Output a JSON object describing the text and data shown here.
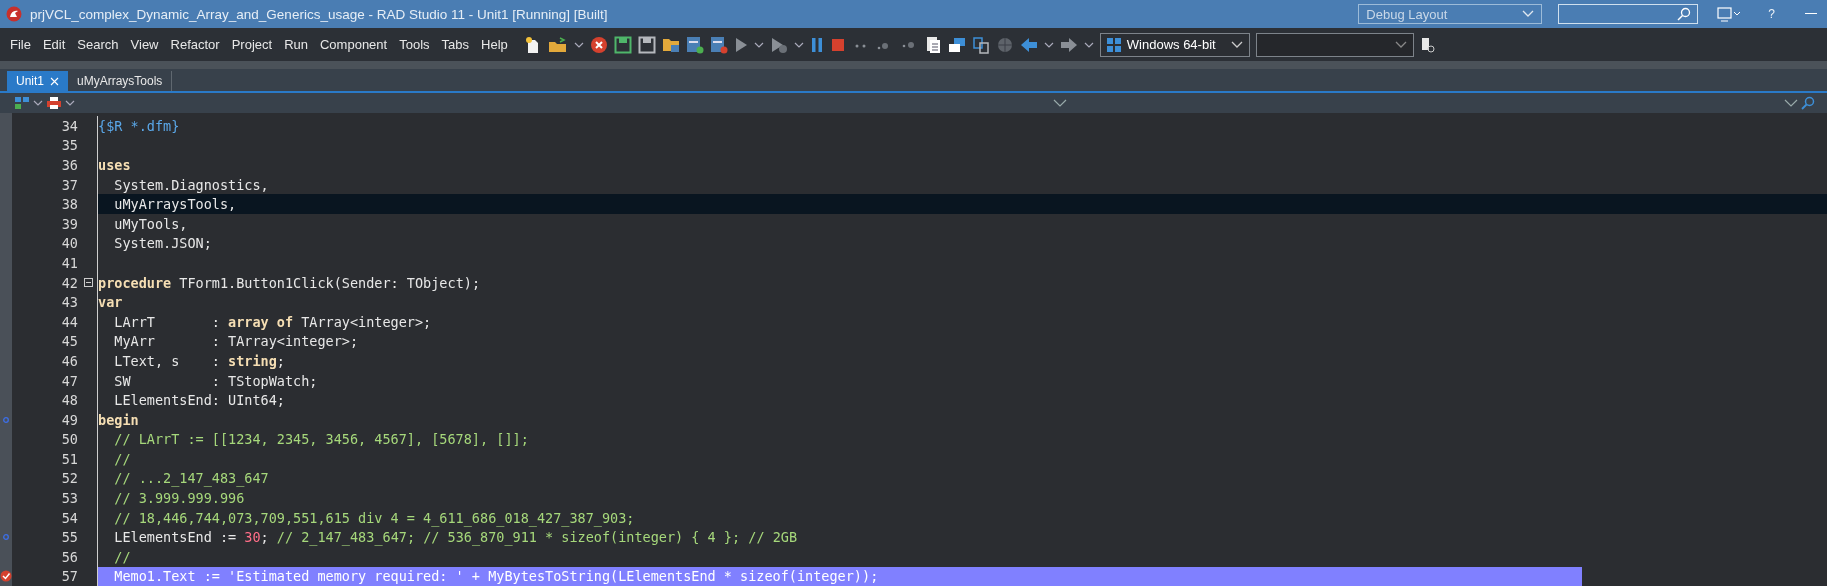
{
  "window": {
    "title": "prjVCL_complex_Dynamic_Array_and_Generics_usage - RAD Studio 11 - Unit1 [Running] [Built]",
    "layout": "Debug Layout",
    "help": "?"
  },
  "menu": [
    "File",
    "Edit",
    "Search",
    "View",
    "Refactor",
    "Project",
    "Run",
    "Component",
    "Tools",
    "Tabs",
    "Help"
  ],
  "platform": "Windows 64-bit",
  "tabs": [
    {
      "label": "Unit1",
      "selected": true
    },
    {
      "label": "uMyArraysTools",
      "selected": false
    }
  ],
  "code": [
    {
      "n": "34",
      "kind": "normal",
      "tokens": [
        {
          "kind": "directive",
          "text": "{$R *.dfm}"
        }
      ]
    },
    {
      "n": "35",
      "kind": "normal"
    },
    {
      "n": "36",
      "kind": "normal",
      "tokens": [
        {
          "kind": "keyword",
          "text": "uses"
        }
      ]
    },
    {
      "n": "37",
      "kind": "normal",
      "tokens": [
        {
          "kind": "plain",
          "text": "  System.Diagnostics,"
        }
      ]
    },
    {
      "n": "38",
      "kind": "caret",
      "tokens": [
        {
          "kind": "plain",
          "text": "  uMyArraysTools,"
        }
      ]
    },
    {
      "n": "39",
      "kind": "normal",
      "tokens": [
        {
          "kind": "plain",
          "text": "  uMyTools,"
        }
      ]
    },
    {
      "n": "40",
      "kind": "normal",
      "tokens": [
        {
          "kind": "plain",
          "text": "  System.JSON;"
        }
      ]
    },
    {
      "n": "41",
      "kind": "normal"
    },
    {
      "n": "42",
      "kind": "normal",
      "fold": {
        "expanded": true
      },
      "tokens": [
        {
          "kind": "keyword",
          "text": "procedure"
        },
        {
          "kind": "plain",
          "text": " TForm1.Button1Click(Sender: TObject);"
        }
      ]
    },
    {
      "n": "43",
      "kind": "normal",
      "tokens": [
        {
          "kind": "keyword",
          "text": "var"
        }
      ]
    },
    {
      "n": "44",
      "kind": "normal",
      "tokens": [
        {
          "kind": "plain",
          "text": "  LArrT       : "
        },
        {
          "kind": "keyword",
          "text": "array of"
        },
        {
          "kind": "plain",
          "text": " TArray<integer>;"
        }
      ]
    },
    {
      "n": "45",
      "kind": "normal",
      "tokens": [
        {
          "kind": "plain",
          "text": "  MyArr       : TArray<integer>;"
        }
      ]
    },
    {
      "n": "46",
      "kind": "normal",
      "tokens": [
        {
          "kind": "plain",
          "text": "  LText, s    : "
        },
        {
          "kind": "keyword",
          "text": "string"
        },
        {
          "kind": "plain",
          "text": ";"
        }
      ]
    },
    {
      "n": "47",
      "kind": "normal",
      "tokens": [
        {
          "kind": "plain",
          "text": "  SW          : TStopWatch;"
        }
      ]
    },
    {
      "n": "48",
      "kind": "normal",
      "tokens": [
        {
          "kind": "plain",
          "text": "  LElementsEnd: UInt64;"
        }
      ]
    },
    {
      "n": "49",
      "kind": "normal",
      "breakpoint": {
        "kind": "dot"
      },
      "tokens": [
        {
          "kind": "keyword",
          "text": "begin"
        }
      ]
    },
    {
      "n": "50",
      "kind": "normal",
      "tokens": [
        {
          "kind": "comment",
          "text": "  // LArrT := [[1234, 2345, 3456, 4567], [5678], []];"
        }
      ]
    },
    {
      "n": "51",
      "kind": "normal",
      "tokens": [
        {
          "kind": "comment",
          "text": "  //"
        }
      ]
    },
    {
      "n": "52",
      "kind": "normal",
      "tokens": [
        {
          "kind": "comment",
          "text": "  // ...2_147_483_647"
        }
      ]
    },
    {
      "n": "53",
      "kind": "normal",
      "tokens": [
        {
          "kind": "comment",
          "text": "  // 3.999.999.996"
        }
      ]
    },
    {
      "n": "54",
      "kind": "normal",
      "tokens": [
        {
          "kind": "comment",
          "text": "  // 18,446,744,073,709,551,615 div 4 = 4_611_686_018_427_387_903;"
        }
      ]
    },
    {
      "n": "55",
      "kind": "normal",
      "breakpoint": {
        "kind": "dot"
      },
      "tokens": [
        {
          "kind": "plain",
          "text": "  LElementsEnd := "
        },
        {
          "kind": "number",
          "text": "30"
        },
        {
          "kind": "plain",
          "text": "; "
        },
        {
          "kind": "comment",
          "text": "// 2_147_483_647; // 536_870_911 * sizeof(integer) { 4 }; // 2GB"
        }
      ]
    },
    {
      "n": "56",
      "kind": "normal",
      "tokens": [
        {
          "kind": "comment",
          "text": "  //"
        }
      ]
    },
    {
      "n": "57",
      "kind": "execution",
      "breakpoint": {
        "kind": "hit"
      },
      "tokens": [
        {
          "kind": "plain",
          "text": "  Memo1.Text := 'Estimated memory required: ' + MyBytesToString(LElementsEnd * sizeof(integer));"
        }
      ]
    }
  ]
}
